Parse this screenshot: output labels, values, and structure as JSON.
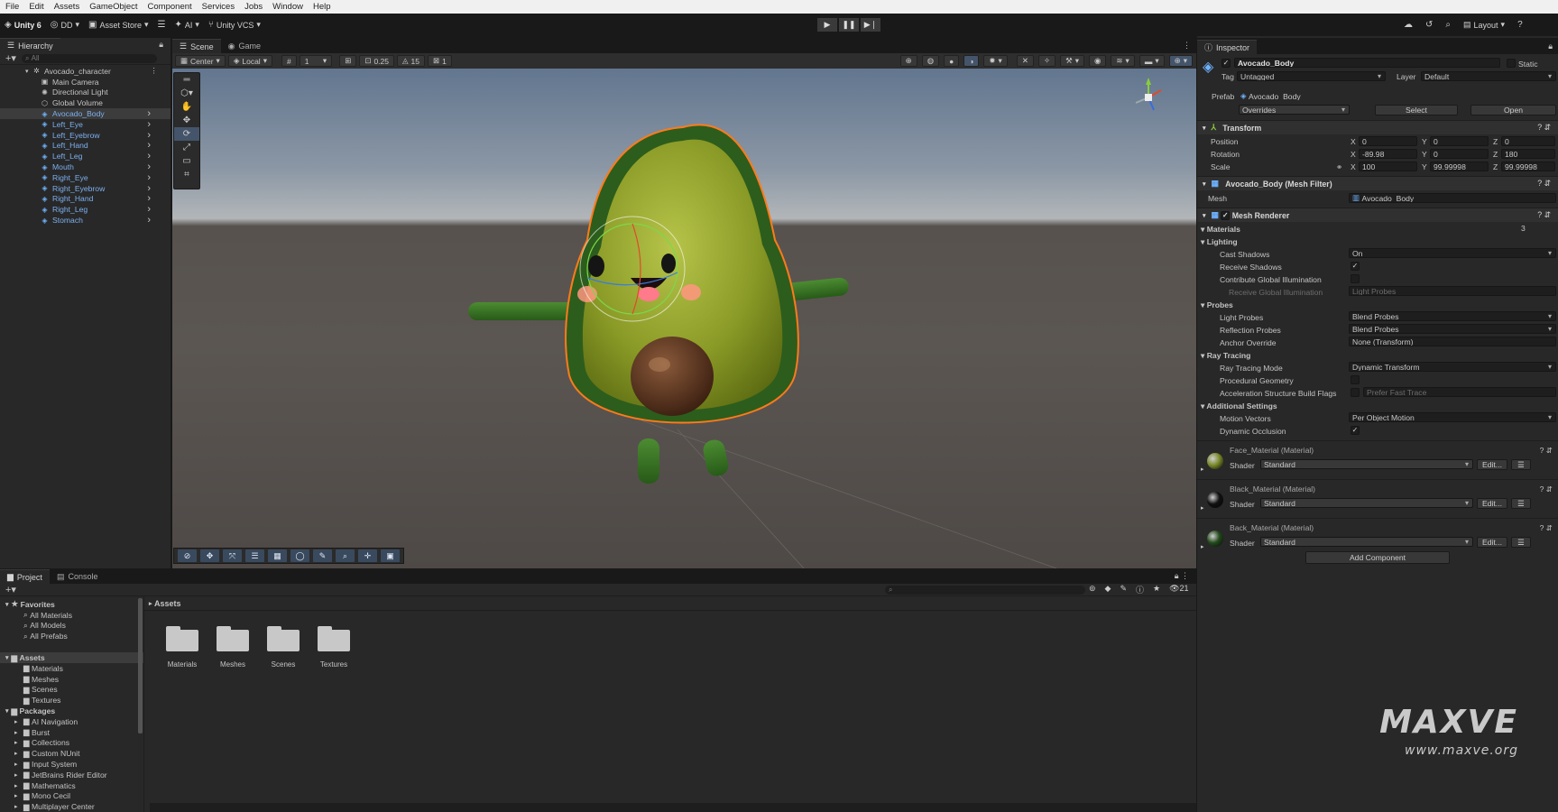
{
  "menubar": [
    "File",
    "Edit",
    "Assets",
    "GameObject",
    "Component",
    "Services",
    "Jobs",
    "Window",
    "Help"
  ],
  "toolbar": {
    "unity": "Unity 6",
    "account": "DD",
    "asset_store": "Asset Store",
    "ai": "AI",
    "vcs": "Unity VCS",
    "layout": "Layout"
  },
  "hierarchy": {
    "tab": "Hierarchy",
    "search_placeholder": "All",
    "root": "Avocado_character",
    "items": [
      {
        "label": "Main Camera",
        "type": "camera"
      },
      {
        "label": "Directional Light",
        "type": "light"
      },
      {
        "label": "Global Volume",
        "type": "volume"
      },
      {
        "label": "Avocado_Body",
        "type": "prefab",
        "selected": true
      },
      {
        "label": "Left_Eye",
        "type": "prefab"
      },
      {
        "label": "Left_Eyebrow",
        "type": "prefab"
      },
      {
        "label": "Left_Hand",
        "type": "prefab"
      },
      {
        "label": "Left_Leg",
        "type": "prefab"
      },
      {
        "label": "Mouth",
        "type": "prefab"
      },
      {
        "label": "Right_Eye",
        "type": "prefab"
      },
      {
        "label": "Right_Eyebrow",
        "type": "prefab"
      },
      {
        "label": "Right_Hand",
        "type": "prefab"
      },
      {
        "label": "Right_Leg",
        "type": "prefab"
      },
      {
        "label": "Stomach",
        "type": "prefab"
      }
    ]
  },
  "scene": {
    "tab_scene": "Scene",
    "tab_game": "Game",
    "pivot": "Center",
    "space": "Local",
    "grid": "1",
    "snap_move": "0.25",
    "snap_rotate": "15",
    "snap_scale": "1"
  },
  "inspector": {
    "tab": "Inspector",
    "object_name": "Avocado_Body",
    "static_label": "Static",
    "tag_label": "Tag",
    "tag": "Untagged",
    "layer_label": "Layer",
    "layer": "Default",
    "prefab_label": "Prefab",
    "prefab": "Avocado_Body",
    "overrides": "Overrides",
    "select": "Select",
    "open": "Open",
    "transform": {
      "title": "Transform",
      "position_label": "Position",
      "rotation_label": "Rotation",
      "scale_label": "Scale",
      "position": [
        "0",
        "0",
        "0"
      ],
      "rotation": [
        "-89.98",
        "0",
        "180"
      ],
      "scale": [
        "100",
        "99.99998",
        "99.99998"
      ]
    },
    "mesh_filter": {
      "title": "Avocado_Body (Mesh Filter)",
      "mesh_label": "Mesh",
      "mesh": "Avocado_Body"
    },
    "mesh_renderer": {
      "title": "Mesh Renderer",
      "materials_label": "Materials",
      "materials_count": "3",
      "lighting": "Lighting",
      "cast_shadows_label": "Cast Shadows",
      "cast_shadows": "On",
      "receive_shadows_label": "Receive Shadows",
      "contribute_gi_label": "Contribute Global Illumination",
      "receive_gi_label": "Receive Global Illumination",
      "receive_gi": "Light Probes",
      "probes": "Probes",
      "light_probes_label": "Light Probes",
      "light_probes": "Blend Probes",
      "reflection_probes_label": "Reflection Probes",
      "reflection_probes": "Blend Probes",
      "anchor_label": "Anchor Override",
      "anchor": "None (Transform)",
      "ray_tracing": "Ray Tracing",
      "rt_mode_label": "Ray Tracing Mode",
      "rt_mode": "Dynamic Transform",
      "procedural_label": "Procedural Geometry",
      "accel_label": "Acceleration Structure Build Flags",
      "accel": "Prefer Fast Trace",
      "additional": "Additional Settings",
      "motion_label": "Motion Vectors",
      "motion": "Per Object Motion",
      "occlusion_label": "Dynamic Occlusion"
    },
    "materials": [
      {
        "name": "Face_Material (Material)",
        "shader_label": "Shader",
        "shader": "Standard",
        "edit": "Edit...",
        "color": "#7a8a2a"
      },
      {
        "name": "Black_Material (Material)",
        "shader_label": "Shader",
        "shader": "Standard",
        "edit": "Edit...",
        "color": "#111111"
      },
      {
        "name": "Back_Material (Material)",
        "shader_label": "Shader",
        "shader": "Standard",
        "edit": "Edit...",
        "color": "#234a1c"
      }
    ],
    "add_component": "Add Component"
  },
  "project": {
    "tab_project": "Project",
    "tab_console": "Console",
    "count": "21",
    "favorites": "Favorites",
    "fav_items": [
      "All Materials",
      "All Models",
      "All Prefabs"
    ],
    "assets": "Assets",
    "asset_items": [
      "Materials",
      "Meshes",
      "Scenes",
      "Textures"
    ],
    "packages": "Packages",
    "package_items": [
      "AI Navigation",
      "Burst",
      "Collections",
      "Custom NUnit",
      "Input System",
      "JetBrains Rider Editor",
      "Mathematics",
      "Mono Cecil",
      "Multiplayer Center"
    ],
    "breadcrumb": "Assets",
    "folders": [
      "Materials",
      "Meshes",
      "Scenes",
      "Textures"
    ]
  },
  "watermark": {
    "logo": "MAXVE",
    "url": "www.maxve.org"
  }
}
